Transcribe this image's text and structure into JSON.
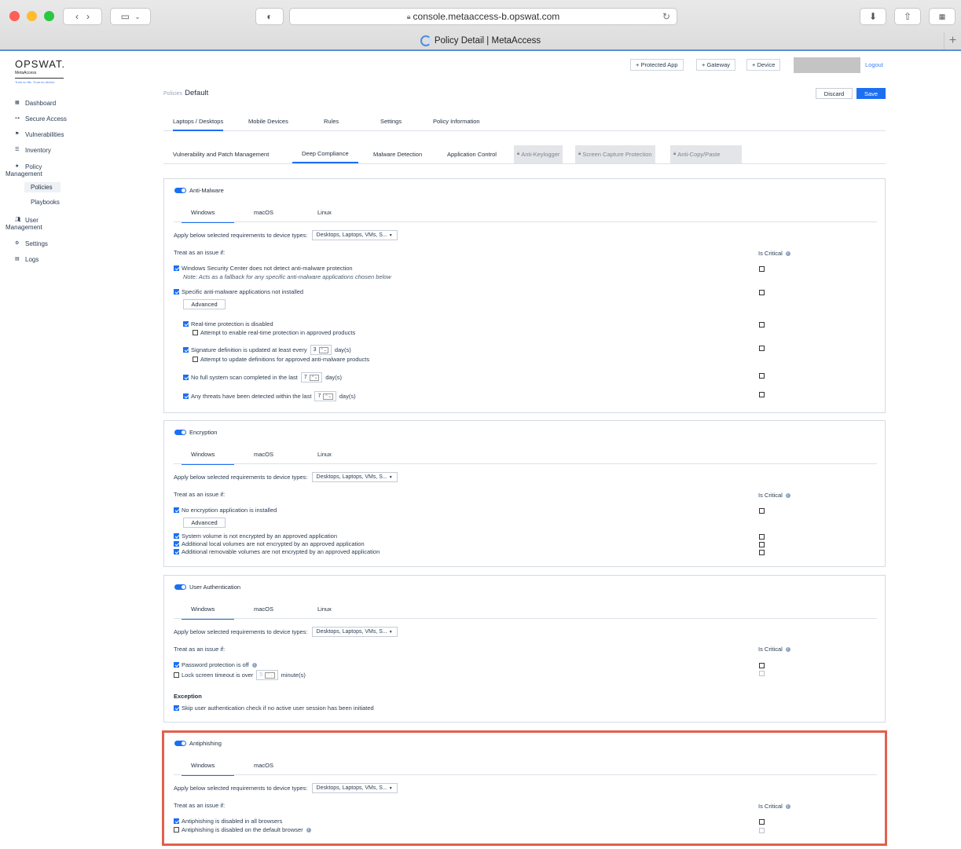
{
  "browser": {
    "url": "console.metaaccess-b.opswat.com",
    "tab_title": "Policy Detail | MetaAccess",
    "new_tab": "+"
  },
  "logo": {
    "brand": "OPSWAT.",
    "product": "MetaAccess",
    "tagline": "Trust no file. Trust no device."
  },
  "sidebar": {
    "items": [
      {
        "label": "Dashboard",
        "icon": "dashboard-icon"
      },
      {
        "label": "Secure Access",
        "icon": "key-icon"
      },
      {
        "label": "Vulnerabilities",
        "icon": "flag-icon"
      },
      {
        "label": "Inventory",
        "icon": "list-icon"
      },
      {
        "label": "Policy Management",
        "icon": "star-icon"
      },
      {
        "label": "User Management",
        "icon": "users-icon"
      },
      {
        "label": "Settings",
        "icon": "gear-icon"
      },
      {
        "label": "Logs",
        "icon": "log-icon"
      }
    ],
    "policy_label_1": "Policy",
    "policy_label_2": "Management",
    "user_label_1": "User",
    "user_label_2": "Management",
    "sub": {
      "policies": "Policies",
      "playbooks": "Playbooks"
    }
  },
  "header": {
    "protected_app": "+ Protected App",
    "gateway": "+ Gateway",
    "device": "+ Device",
    "logout": "Logout"
  },
  "breadcrumb": {
    "parent": "Policies",
    "current": "Default"
  },
  "actions": {
    "discard": "Discard",
    "save": "Save"
  },
  "tabs": [
    "Laptops / Desktops",
    "Mobile Devices",
    "Rules",
    "Settings",
    "Policy Information"
  ],
  "subtabs": [
    "Vulnerability and Patch Management",
    "Deep Compliance",
    "Malware Detection",
    "Application Control",
    "Anti-Keylogger",
    "Screen Capture Protection",
    "Anti-Copy/Paste"
  ],
  "common": {
    "apply_text": "Apply below selected requirements to device types:",
    "device_types": "Desktops, Laptops, VMs, S...",
    "treat": "Treat as an issue if:",
    "is_critical": "Is Critical",
    "advanced": "Advanced",
    "days": "day(s)",
    "minutes": "minute(s)"
  },
  "os": {
    "windows": "Windows",
    "macos": "macOS",
    "linux": "Linux"
  },
  "anti_malware": {
    "title": "Anti-Malware",
    "wsc": "Windows Security Center does not detect anti-malware protection",
    "wsc_note": "Note: Acts as a fallback for any specific anti-malware applications chosen below",
    "specific": "Specific anti-malware applications not installed",
    "realtime": "Real-time protection is disabled",
    "realtime_attempt": "Attempt to enable real-time protection in approved products",
    "signature": "Signature definition is updated at least every",
    "signature_value": "3",
    "signature_attempt": "Attempt to update definitions for approved anti-malware products",
    "full_scan": "No full system scan completed in the last",
    "full_scan_value": "7",
    "threats": "Any threats have been detected within the last",
    "threats_value": "7"
  },
  "encryption": {
    "title": "Encryption",
    "no_app": "No encryption application is installed",
    "system_volume": "System volume is not encrypted by an approved application",
    "local_volumes": "Additional local volumes are not encrypted by an approved application",
    "removable_volumes": "Additional removable volumes are not encrypted by an approved application"
  },
  "user_auth": {
    "title": "User Authentication",
    "password_off": "Password protection is off",
    "lock_timeout": "Lock screen timeout is over",
    "lock_value": "5",
    "exception": "Exception",
    "skip": "Skip user authentication check if no active user session has been initiated"
  },
  "antiphishing": {
    "title": "Antiphishing",
    "all_browsers": "Antiphishing is disabled in all browsers",
    "default_browser": "Antiphishing is disabled on the default browser"
  },
  "colors": {
    "accent": "#1d6ff2",
    "highlight": "#e2604c"
  }
}
